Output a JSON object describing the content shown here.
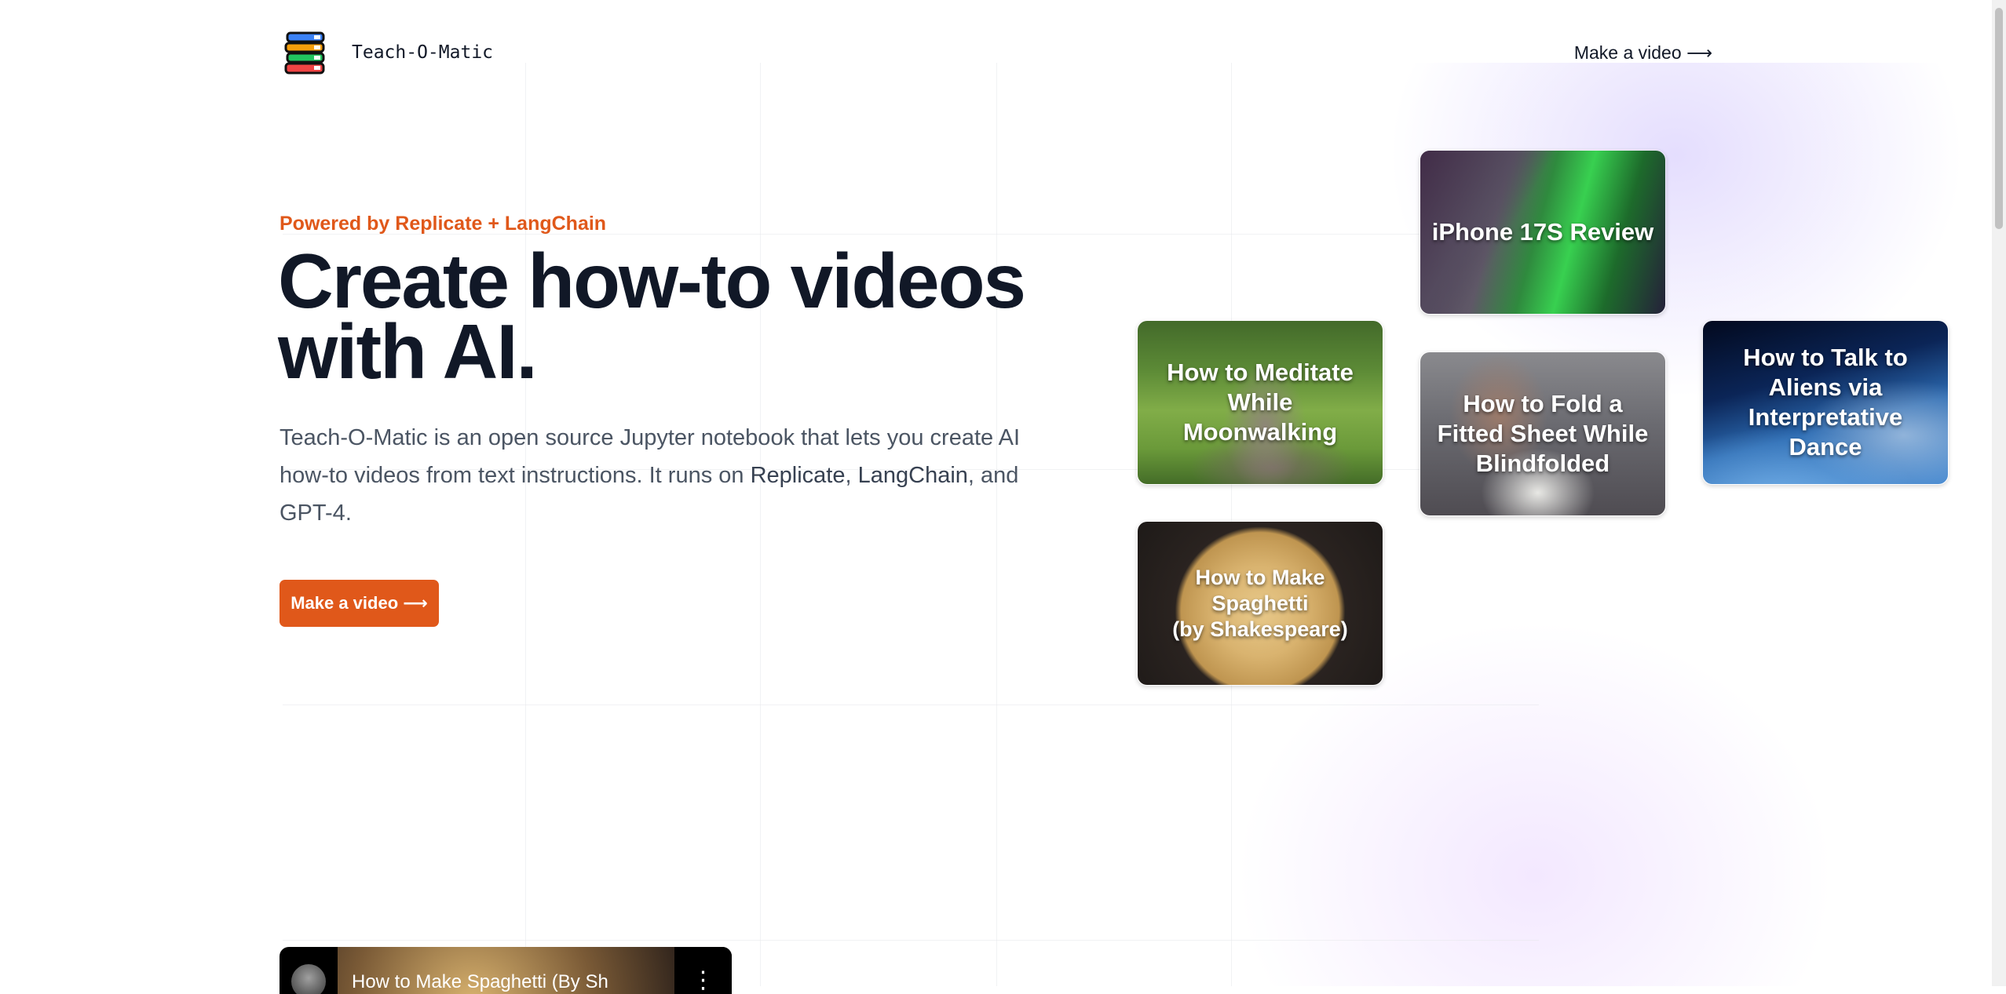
{
  "header": {
    "brand": "Teach-O-Matic",
    "cta_label": "Make a video ⟶"
  },
  "hero": {
    "eyebrow": "Powered by Replicate + LangChain",
    "title_line1": "Create how-to videos",
    "title_line2": "with AI.",
    "desc_text_1": "Teach-O-Matic is an open source Jupyter notebook that lets you create AI how-to videos from text instructions. It runs on ",
    "desc_replicate": "Replicate",
    "desc_comma": ", ",
    "desc_langchain": "LangChain",
    "desc_and": ", and ",
    "desc_gpt4": "GPT-4",
    "desc_period": ".",
    "button_label": "Make a video ⟶"
  },
  "cards": [
    {
      "title": "iPhone 17S Review"
    },
    {
      "title": "How to Meditate While Moonwalking"
    },
    {
      "title": "How to Fold a Fitted Sheet While Blindfolded"
    },
    {
      "title": "How to Talk to Aliens via Interpretative Dance"
    },
    {
      "title_line1": "How to Make Spaghetti",
      "title_line2": "(by Shakespeare)"
    }
  ],
  "video_preview": {
    "title": "How to Make Spaghetti (By Sh",
    "menu_icon": "more-vertical-icon"
  },
  "colors": {
    "accent": "#e0581a",
    "heading": "#111827",
    "body_text": "#4b5563",
    "background": "#ffffff"
  },
  "icons": {
    "logo": "stacked-books-logo"
  }
}
